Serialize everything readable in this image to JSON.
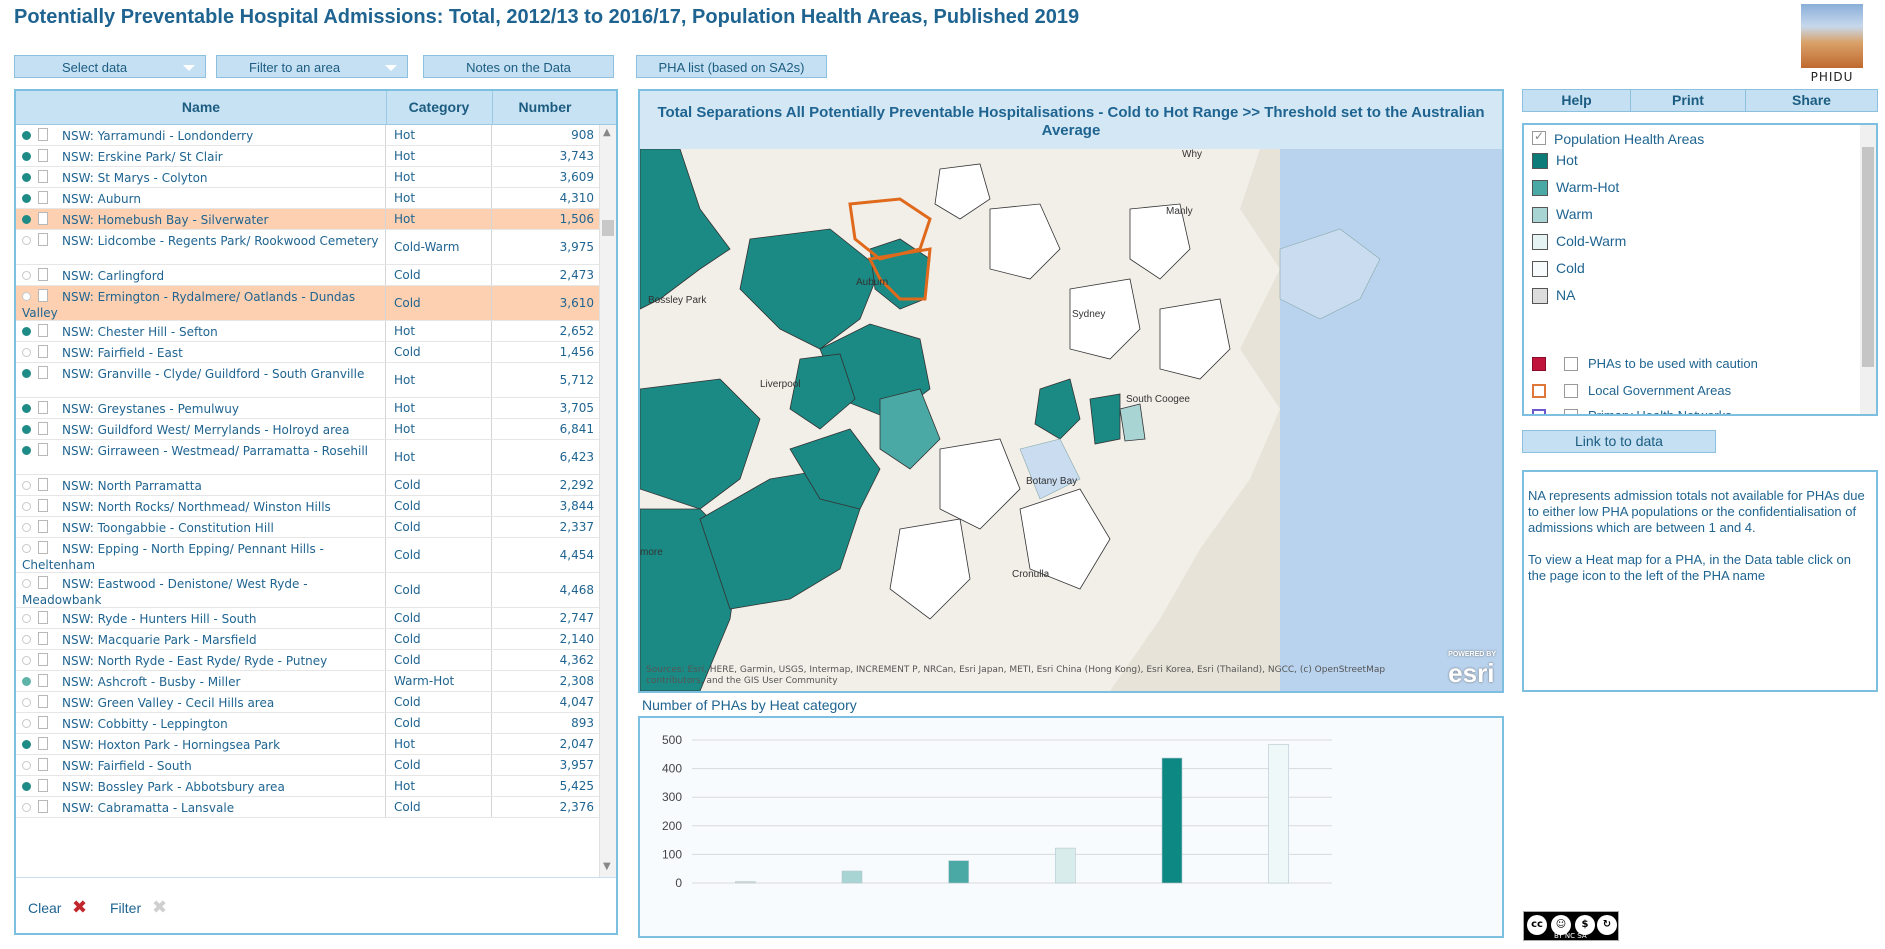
{
  "title": "Potentially Preventable Hospital Admissions: Total, 2012/13 to 2016/17, Population Health Areas, Published 2019",
  "logo_text": "PHIDU",
  "toolbar": {
    "select_data": "Select data",
    "filter_area": "Filter to an area",
    "notes": "Notes on the Data",
    "pha_list": "PHA list (based on SA2s)"
  },
  "table": {
    "headers": [
      "Name",
      "Category",
      "Number"
    ],
    "rows": [
      {
        "name": "NSW: Yarramundi - Londonderry",
        "category": "Hot",
        "number": "908",
        "dot": "on"
      },
      {
        "name": "NSW: Erskine Park/ St Clair",
        "category": "Hot",
        "number": "3,743",
        "dot": "on"
      },
      {
        "name": "NSW: St Marys - Colyton",
        "category": "Hot",
        "number": "3,609",
        "dot": "on"
      },
      {
        "name": "NSW: Auburn",
        "category": "Hot",
        "number": "4,310",
        "dot": "on"
      },
      {
        "name": "NSW: Homebush Bay - Silverwater",
        "category": "Hot",
        "number": "1,506",
        "dot": "on",
        "selected": true
      },
      {
        "name": "NSW: Lidcombe - Regents Park/ Rookwood Cemetery",
        "category": "Cold-Warm",
        "number": "3,975",
        "dot": "off"
      },
      {
        "name": "NSW: Carlingford",
        "category": "Cold",
        "number": "2,473",
        "dot": "off"
      },
      {
        "name": "NSW: Ermington - Rydalmere/ Oatlands - Dundas Valley",
        "category": "Cold",
        "number": "3,610",
        "dot": "off",
        "selected": true
      },
      {
        "name": "NSW: Chester Hill - Sefton",
        "category": "Hot",
        "number": "2,652",
        "dot": "on"
      },
      {
        "name": "NSW: Fairfield - East",
        "category": "Cold",
        "number": "1,456",
        "dot": "off"
      },
      {
        "name": "NSW: Granville - Clyde/ Guildford - South Granville",
        "category": "Hot",
        "number": "5,712",
        "dot": "on"
      },
      {
        "name": "NSW: Greystanes - Pemulwuy",
        "category": "Hot",
        "number": "3,705",
        "dot": "on"
      },
      {
        "name": "NSW: Guildford West/ Merrylands - Holroyd area",
        "category": "Hot",
        "number": "6,841",
        "dot": "on"
      },
      {
        "name": "NSW: Girraween - Westmead/ Parramatta - Rosehill",
        "category": "Hot",
        "number": "6,423",
        "dot": "on"
      },
      {
        "name": "NSW: North Parramatta",
        "category": "Cold",
        "number": "2,292",
        "dot": "off"
      },
      {
        "name": "NSW: North Rocks/ Northmead/ Winston Hills",
        "category": "Cold",
        "number": "3,844",
        "dot": "off"
      },
      {
        "name": "NSW: Toongabbie - Constitution Hill",
        "category": "Cold",
        "number": "2,337",
        "dot": "off"
      },
      {
        "name": "NSW: Epping - North Epping/ Pennant Hills - Cheltenham",
        "category": "Cold",
        "number": "4,454",
        "dot": "off"
      },
      {
        "name": "NSW: Eastwood - Denistone/ West Ryde - Meadowbank",
        "category": "Cold",
        "number": "4,468",
        "dot": "off"
      },
      {
        "name": "NSW: Ryde - Hunters Hill - South",
        "category": "Cold",
        "number": "2,747",
        "dot": "off"
      },
      {
        "name": "NSW: Macquarie Park - Marsfield",
        "category": "Cold",
        "number": "2,140",
        "dot": "off"
      },
      {
        "name": "NSW: North Ryde - East Ryde/ Ryde - Putney",
        "category": "Cold",
        "number": "4,362",
        "dot": "off"
      },
      {
        "name": "NSW: Ashcroft - Busby - Miller",
        "category": "Warm-Hot",
        "number": "2,308",
        "dot": "mid"
      },
      {
        "name": "NSW: Green Valley - Cecil Hills area",
        "category": "Cold",
        "number": "4,047",
        "dot": "off"
      },
      {
        "name": "NSW: Cobbitty - Leppington",
        "category": "Cold",
        "number": "893",
        "dot": "off"
      },
      {
        "name": "NSW: Hoxton Park - Horningsea Park",
        "category": "Hot",
        "number": "2,047",
        "dot": "on"
      },
      {
        "name": "NSW: Fairfield - South",
        "category": "Cold",
        "number": "3,957",
        "dot": "off"
      },
      {
        "name": "NSW: Bossley Park - Abbotsbury area",
        "category": "Hot",
        "number": "5,425",
        "dot": "on"
      },
      {
        "name": "NSW: Cabramatta - Lansvale",
        "category": "Cold",
        "number": "2,376",
        "dot": "off"
      }
    ],
    "footer": {
      "clear": "Clear",
      "filter": "Filter"
    }
  },
  "map": {
    "title": "Total Separations All Potentially Preventable Hospitalisations - Cold to Hot Range >>  Threshold set to the Australian Average",
    "sources": "Sources: Esri, HERE, Garmin, USGS, Intermap, INCREMENT P, NRCan, Esri Japan, METI, Esri China (Hong Kong), Esri Korea, Esri (Thailand), NGCC, (c) OpenStreetMap contributors, and the GIS User Community",
    "powered_by": "POWERED BY",
    "esri": "esri",
    "labels": {
      "why": "Why",
      "manly": "Manly",
      "south_coogee": "South Coogee",
      "botany_bay": "Botany Bay",
      "bossley": "Bossley Park",
      "sydney": "Sydney",
      "cronulla": "Cronulla",
      "liverpool": "Liverpool",
      "auburn": "Auburn",
      "more": "more"
    }
  },
  "chart_data": {
    "type": "bar",
    "title": "Number of PHAs by Heat category",
    "categories": [
      "NA",
      "Warm",
      "Warm-Hot",
      "Cold-Warm",
      "Hot",
      "Cold"
    ],
    "values": [
      5,
      42,
      78,
      122,
      437,
      485
    ],
    "colors": [
      "#d9d9d9",
      "#a8d4d3",
      "#4aa9a5",
      "#d8ecec",
      "#0d8883",
      "#eef8f9"
    ],
    "ylim": [
      0,
      520
    ],
    "yticks": [
      0,
      100,
      200,
      300,
      400,
      500
    ],
    "grid": true
  },
  "right": {
    "buttons": [
      "Help",
      "Print",
      "Share"
    ],
    "legend": {
      "group_label": "Population Health Areas",
      "items": [
        {
          "label": "Hot",
          "color": "#0d7c78"
        },
        {
          "label": "Warm-Hot",
          "color": "#4aa9a5"
        },
        {
          "label": "Warm",
          "color": "#a8d4d3"
        },
        {
          "label": "Cold-Warm",
          "color": "#e6f3f3"
        },
        {
          "label": "Cold",
          "color": "#f7fbfb"
        },
        {
          "label": "NA",
          "color": "#dcdcdc"
        }
      ],
      "caution_label": "PHAs to be used with caution",
      "lga_label": "Local Government Areas",
      "phn_label": "Primary Health Networks"
    },
    "link_data": "Link to to data",
    "notes": [
      "NA represents admission totals not available for PHAs due to either low PHA populations or the confidentialisation of admissions which are between 1 and 4.",
      "To view a Heat map for a PHA, in the Data table click on the page icon to the left of the PHA name"
    ],
    "cc_label": "BY NC SA"
  }
}
